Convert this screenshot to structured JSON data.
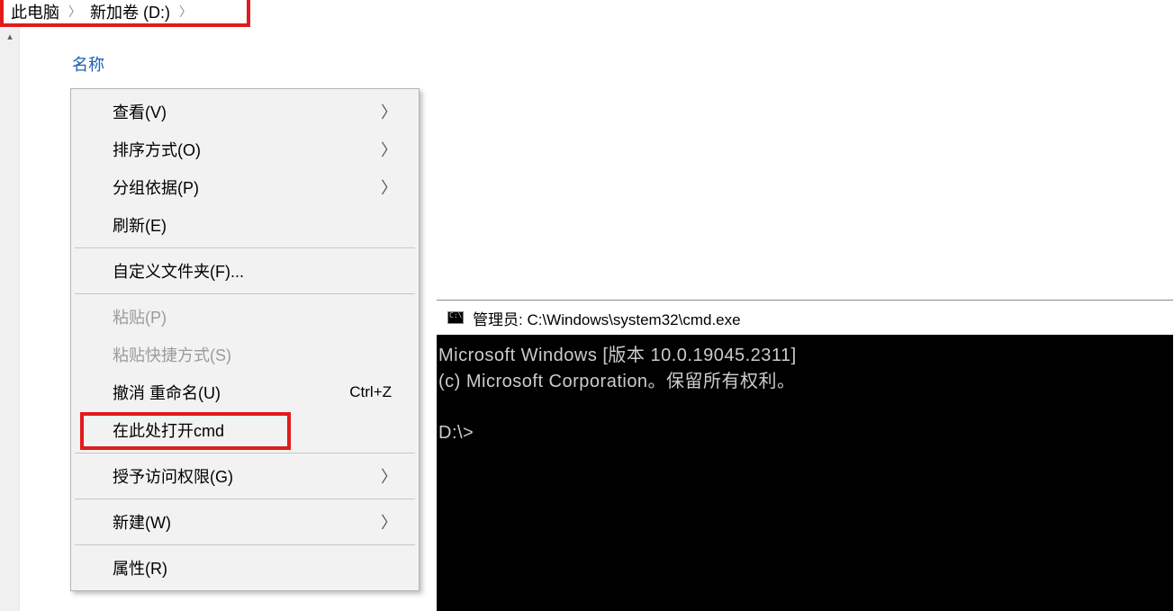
{
  "breadcrumb": {
    "seg1": "此电脑",
    "seg2": "新加卷 (D:)"
  },
  "explorer": {
    "column_name": "名称"
  },
  "menu": {
    "view": "查看(V)",
    "sort": "排序方式(O)",
    "group": "分组依据(P)",
    "refresh": "刷新(E)",
    "customize": "自定义文件夹(F)...",
    "paste": "粘贴(P)",
    "paste_shortcut": "粘贴快捷方式(S)",
    "undo": "撤消 重命名(U)",
    "undo_shortcut": "Ctrl+Z",
    "open_cmd": "在此处打开cmd",
    "access": "授予访问权限(G)",
    "new": "新建(W)",
    "properties": "属性(R)"
  },
  "cmd": {
    "title": "管理员: C:\\Windows\\system32\\cmd.exe",
    "line1": "Microsoft Windows [版本 10.0.19045.2311]",
    "line2": "(c) Microsoft Corporation。保留所有权利。",
    "prompt": "D:\\>"
  }
}
